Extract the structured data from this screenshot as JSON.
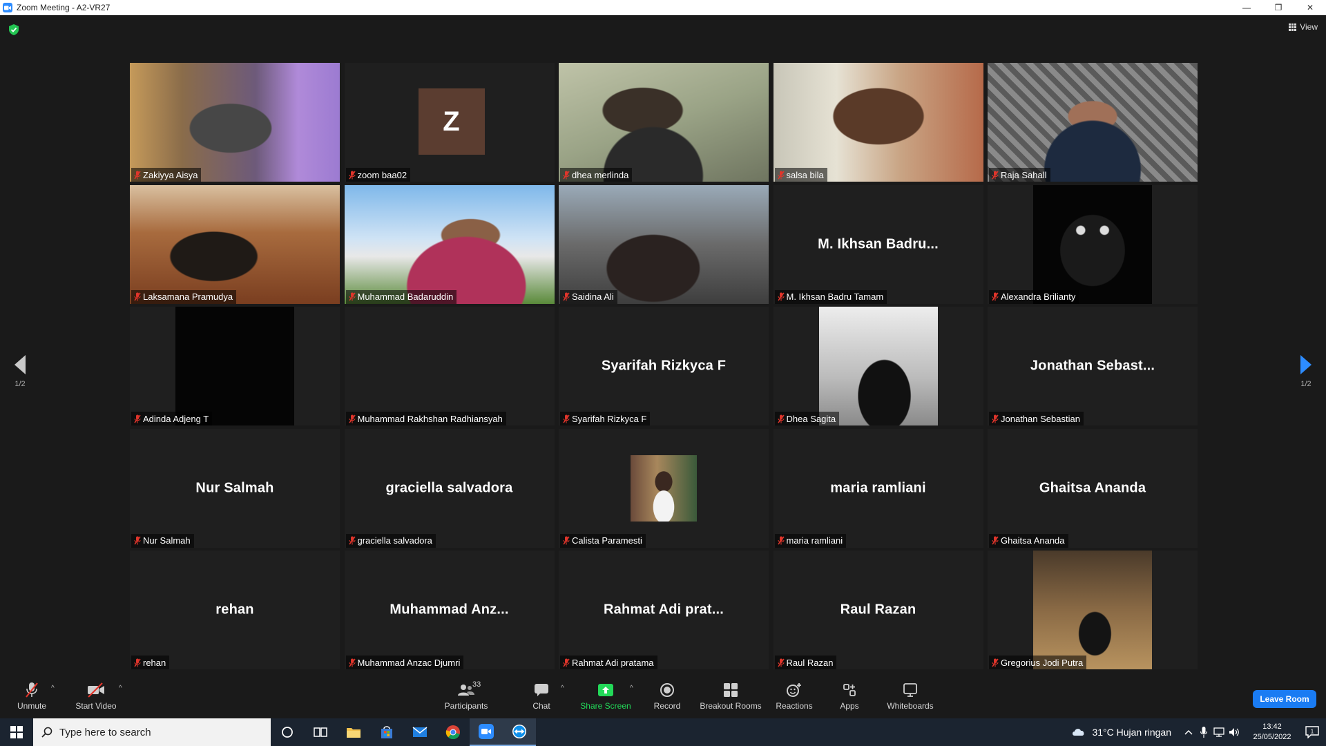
{
  "window": {
    "title": "Zoom Meeting - A2-VR27",
    "minimize": "—",
    "restore": "❐",
    "close": "✕"
  },
  "top": {
    "view_label": "View"
  },
  "pagination": {
    "left_page": "1/2",
    "right_page": "1/2"
  },
  "participants": [
    {
      "name": "Zakiyya Aisya",
      "display": "",
      "photo": "zakiyya"
    },
    {
      "name": "zoom baa02",
      "display": "",
      "avatar_letter": "Z"
    },
    {
      "name": "dhea merlinda",
      "display": "",
      "photo": "dhea"
    },
    {
      "name": "salsa bila",
      "display": "",
      "photo": "salsa"
    },
    {
      "name": "Raja Sahall",
      "display": "",
      "photo": "raja"
    },
    {
      "name": "Laksamana Pramudya",
      "display": "",
      "photo": "laksamana"
    },
    {
      "name": "Muhammad Badaruddin",
      "display": "",
      "photo": "badaruddin",
      "active_speaker": true
    },
    {
      "name": "Saidina Ali",
      "display": "",
      "photo": "saidina"
    },
    {
      "name": "M. Ikhsan Badru Tamam",
      "display": "M. Ikhsan Badru..."
    },
    {
      "name": "Alexandra Brilianty",
      "display": "",
      "photo": "cat"
    },
    {
      "name": "Adinda Adjeng T",
      "display": "",
      "photo": "adinda"
    },
    {
      "name": "Muhammad Rakhshan Radhiansyah",
      "display": ""
    },
    {
      "name": "Syarifah Rizkyca F",
      "display": "Syarifah Rizkyca F"
    },
    {
      "name": "Dhea Sagita",
      "display": "",
      "photo": "dheasagita"
    },
    {
      "name": "Jonathan Sebastian",
      "display": "Jonathan Sebast..."
    },
    {
      "name": "Nur Salmah",
      "display": "Nur Salmah"
    },
    {
      "name": "graciella salvadora",
      "display": "graciella salvadora"
    },
    {
      "name": "Calista Paramesti",
      "display": "",
      "photo": "calista"
    },
    {
      "name": "maria ramliani",
      "display": "maria ramliani"
    },
    {
      "name": "Ghaitsa Ananda",
      "display": "Ghaitsa Ananda"
    },
    {
      "name": "rehan",
      "display": "rehan"
    },
    {
      "name": "Muhammad Anzac Djumri",
      "display": "Muhammad Anz..."
    },
    {
      "name": "Rahmat Adi pratama",
      "display": "Rahmat Adi prat..."
    },
    {
      "name": "Raul Razan",
      "display": "Raul Razan"
    },
    {
      "name": "Gregorius Jodi Putra",
      "display": "",
      "photo": "gregorius"
    }
  ],
  "toolbar": {
    "unmute": "Unmute",
    "start_video": "Start Video",
    "participants": "Participants",
    "participants_count": "33",
    "chat": "Chat",
    "share_screen": "Share Screen",
    "record": "Record",
    "breakout_rooms": "Breakout Rooms",
    "reactions": "Reactions",
    "apps": "Apps",
    "whiteboards": "Whiteboards",
    "leave": "Leave Room"
  },
  "taskbar": {
    "search_placeholder": "Type here to search",
    "weather": "31°C  Hujan ringan",
    "time": "13:42",
    "date": "25/05/2022",
    "notification_count": "1"
  },
  "colors": {
    "accent": "#2d8cff",
    "active_speaker_border": "#f8f75a",
    "share_green": "#23d959",
    "muted_red": "#e0352b",
    "leave_blue": "#1a7cf3"
  }
}
